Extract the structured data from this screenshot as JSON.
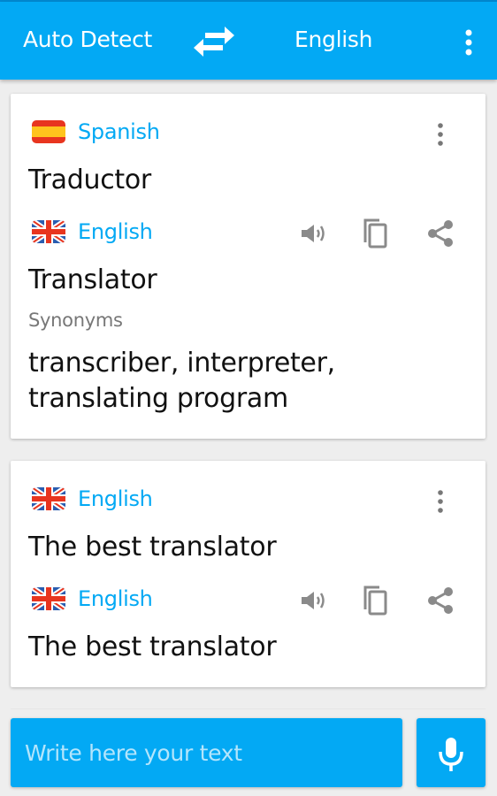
{
  "appbar": {
    "source_language": "Auto Detect",
    "target_language": "English",
    "swap_icon": "swap-arrows-icon",
    "menu_icon": "more-vert-icon"
  },
  "cards": [
    {
      "source": {
        "flag": "spain-flag",
        "language": "Spanish",
        "text": "Traductor"
      },
      "target": {
        "flag": "uk-flag",
        "language": "English",
        "text": "Translator"
      },
      "synonyms_label": "Synonyms",
      "synonyms": "transcriber, interpreter, translating program",
      "actions": [
        "speaker-icon",
        "copy-icon",
        "share-icon"
      ]
    },
    {
      "source": {
        "flag": "uk-flag",
        "language": "English",
        "text": "The best translator"
      },
      "target": {
        "flag": "uk-flag",
        "language": "English",
        "text": "The best translator"
      },
      "actions": [
        "speaker-icon",
        "copy-icon",
        "share-icon"
      ]
    }
  ],
  "input": {
    "placeholder": "Write here your text",
    "value": ""
  },
  "mic_icon": "microphone-icon",
  "colors": {
    "primary": "#03A9F4",
    "status_bar": "#0288D1",
    "background": "#EEEEEE",
    "icon_gray": "#8A8A8A",
    "placeholder": "#B3E5FC"
  }
}
